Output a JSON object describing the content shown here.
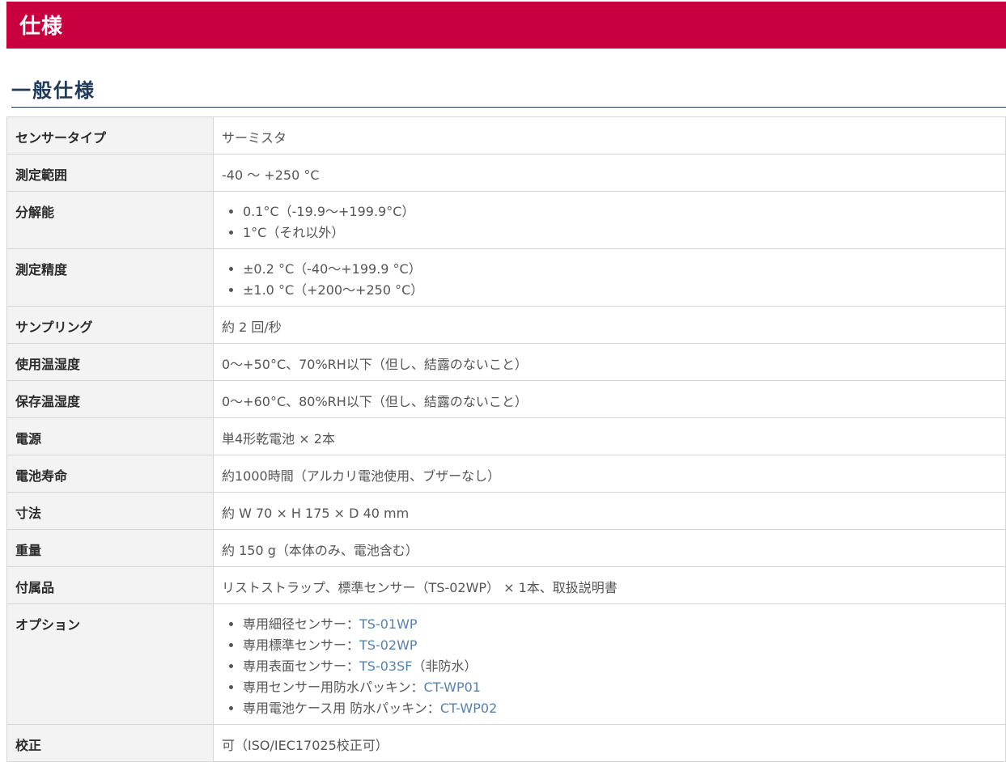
{
  "header": {
    "title": "仕様"
  },
  "section": {
    "title": "一般仕様"
  },
  "colors": {
    "banner": "#c8003f",
    "heading": "#1f3a5a",
    "link": "#5580b0"
  },
  "specs": [
    {
      "label": "センサータイプ",
      "value": "サーミスタ"
    },
    {
      "label": "測定範囲",
      "value": "-40 ～ +250 °C"
    },
    {
      "label": "分解能",
      "items": [
        "0.1°C（-19.9～+199.9°C）",
        "1°C（それ以外）"
      ]
    },
    {
      "label": "測定精度",
      "items": [
        "±0.2 °C（-40～+199.9 °C）",
        "±1.0 °C（+200～+250 °C）"
      ]
    },
    {
      "label": "サンプリング",
      "value": "約 2 回/秒"
    },
    {
      "label": "使用温湿度",
      "value": "0～+50°C、70%RH以下（但し、結露のないこと）"
    },
    {
      "label": "保存温湿度",
      "value": "0～+60°C、80%RH以下（但し、結露のないこと）"
    },
    {
      "label": "電源",
      "value": "単4形乾電池 × 2本"
    },
    {
      "label": "電池寿命",
      "value": "約1000時間（アルカリ電池使用、ブザーなし）"
    },
    {
      "label": "寸法",
      "value": "約 W 70 × H 175 × D 40 mm"
    },
    {
      "label": "重量",
      "value": "約 150 g（本体のみ、電池含む）"
    },
    {
      "label": "付属品",
      "value": "リストストラップ、標準センサー（TS-02WP） × 1本、取扱説明書"
    },
    {
      "label": "オプション",
      "items": [
        {
          "text": "専用細径センサー：",
          "link": "TS-01WP",
          "suffix": ""
        },
        {
          "text": "専用標準センサー：",
          "link": "TS-02WP",
          "suffix": ""
        },
        {
          "text": "専用表面センサー：",
          "link": "TS-03SF",
          "suffix": "（非防水）"
        },
        {
          "text": "専用センサー用防水パッキン：",
          "link": "CT-WP01",
          "suffix": ""
        },
        {
          "text": "専用電池ケース用 防水パッキン：",
          "link": "CT-WP02",
          "suffix": ""
        }
      ]
    },
    {
      "label": "校正",
      "value": "可（ISO/IEC17025校正可）"
    }
  ]
}
